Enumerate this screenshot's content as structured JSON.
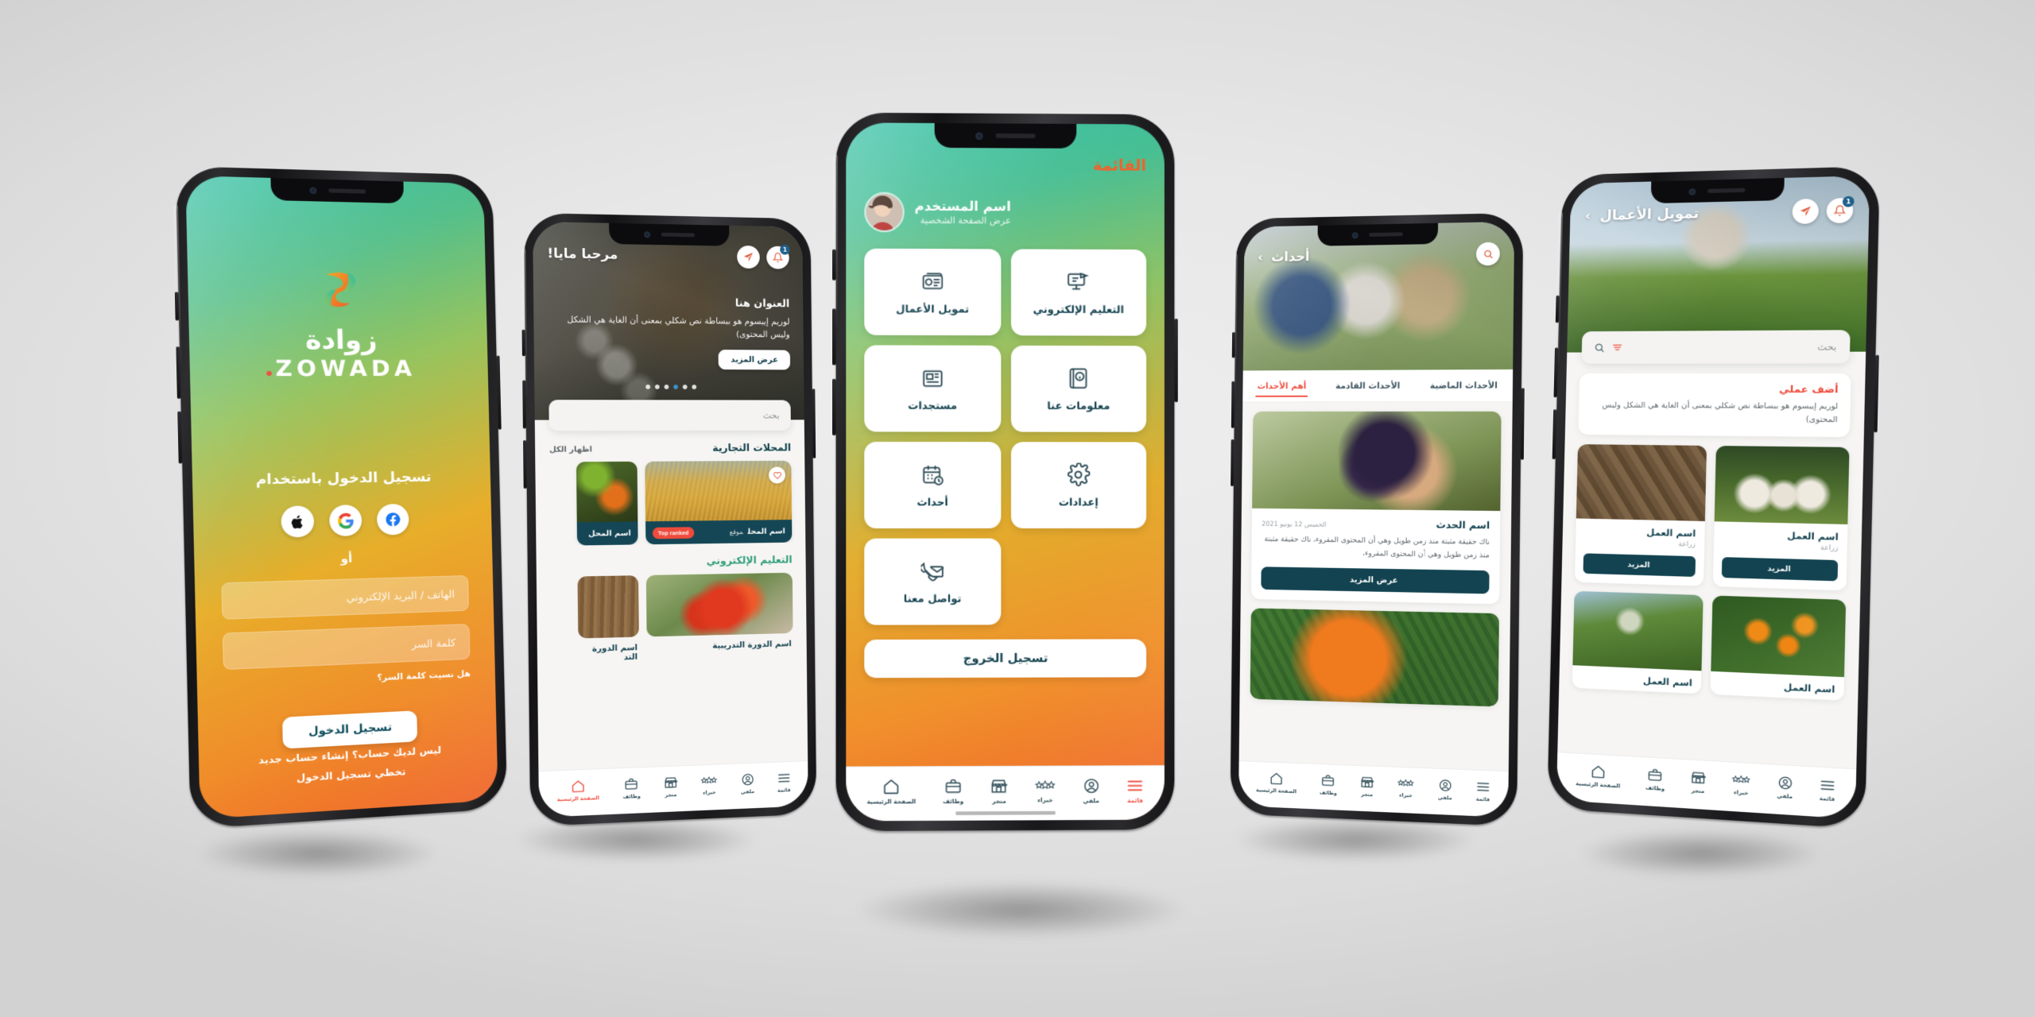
{
  "brand": {
    "name_ar": "زوادة",
    "name_en": "ZOWADA",
    "accent_orange": "#f0622b",
    "accent_red": "#ef4b3c",
    "accent_teal": "#134350",
    "accent_green": "#2f9e7b"
  },
  "login": {
    "title": "تسجيل الدخول باستخدام",
    "or": "أو",
    "phone_placeholder": "الهاتف / البريد الإلكتروني",
    "password_placeholder": "كلمة السر",
    "forgot": "هل نسيت كلمة السر؟",
    "submit": "تسجيل الدخول",
    "no_account": "ليس لديك حساب؟ إنشاء حساب جديد",
    "skip": "تخطي تسجيل الدخول",
    "social": [
      "facebook-icon",
      "google-icon",
      "apple-icon"
    ]
  },
  "home": {
    "greeting": "مرحبا مايا!",
    "notifications_badge": "1",
    "hero": {
      "title": "العنوان هنا",
      "body": "لوريم إيبسوم هو ببساطة نص شكلي بمعنى أن الغاية هي الشكل وليس المحتوى)",
      "cta": "عرض المزيد"
    },
    "search_placeholder": "بحث",
    "sections": [
      {
        "title": "المحلات التجارية",
        "link": "اظهار الكل",
        "cards": [
          {
            "name": "اسم المحل",
            "location": "موقع",
            "tag": "Top ranked"
          },
          {
            "name": "اسم المحل",
            "location": "",
            "tag": ""
          }
        ]
      },
      {
        "title": "التعليم الإلكتروني",
        "link": "",
        "courses": [
          {
            "name": "اسم الدورة التدريبية"
          },
          {
            "name": "اسم الدورة التد"
          }
        ]
      }
    ]
  },
  "menu": {
    "title": "القائمة",
    "user_name": "اسم المستخدم",
    "user_sub": "عرض الصفحة الشخصية",
    "tiles": [
      {
        "label": "تمويل الأعمال",
        "icon": "finance-icon"
      },
      {
        "label": "التعليم الإلكتروني",
        "icon": "elearning-icon"
      },
      {
        "label": "مستجدات",
        "icon": "news-icon"
      },
      {
        "label": "معلومات عنا",
        "icon": "about-icon"
      },
      {
        "label": "أحداث",
        "icon": "events-icon"
      },
      {
        "label": "إعدادات",
        "icon": "settings-icon"
      },
      {
        "label": "تواصل معنا",
        "icon": "contact-icon"
      }
    ],
    "logout": "تسجيل الخروج"
  },
  "events": {
    "title": "أحداث",
    "tabs": [
      {
        "label": "أهم الأحداث",
        "active": true
      },
      {
        "label": "الأحداث القادمة",
        "active": false
      },
      {
        "label": "الأحداث الماضية",
        "active": false
      }
    ],
    "cards": [
      {
        "name": "اسم الحدث",
        "date": "الخميس 12 يونيو 2021",
        "body": "ناك حقيقة مثبتة منذ زمن طويل وهي أن المحتوى المقروء، ناك حقيقة مثبتة منذ زمن طويل وهي أن المحتوى المقروء،",
        "cta": "عرض المزيد"
      }
    ]
  },
  "finance": {
    "title": "تمويل الأعمال",
    "notifications_badge": "1",
    "search_placeholder": "بحث",
    "add": {
      "title": "أضف عملي",
      "body": "لوريم إيبسوم هو ببساطة نص شكلي بمعنى أن الغاية هي الشكل وليس المحتوى)"
    },
    "businesses": [
      {
        "name": "اسم العمل",
        "category": "زراعة",
        "cta": "المزيد"
      },
      {
        "name": "اسم العمل",
        "category": "زراعة",
        "cta": "المزيد"
      },
      {
        "name": "اسم العمل",
        "category": "",
        "cta": ""
      },
      {
        "name": "اسم العمل",
        "category": "",
        "cta": ""
      }
    ]
  },
  "tabbar": {
    "items": [
      {
        "label": "قائمة",
        "icon": "hamburger-icon"
      },
      {
        "label": "ملفي",
        "icon": "profile-icon"
      },
      {
        "label": "خبراء",
        "icon": "stars-icon"
      },
      {
        "label": "متجر",
        "icon": "store-icon"
      },
      {
        "label": "وظائف",
        "icon": "briefcase-icon"
      },
      {
        "label": "الصفحة الرئيسية",
        "icon": "home-icon"
      }
    ]
  }
}
